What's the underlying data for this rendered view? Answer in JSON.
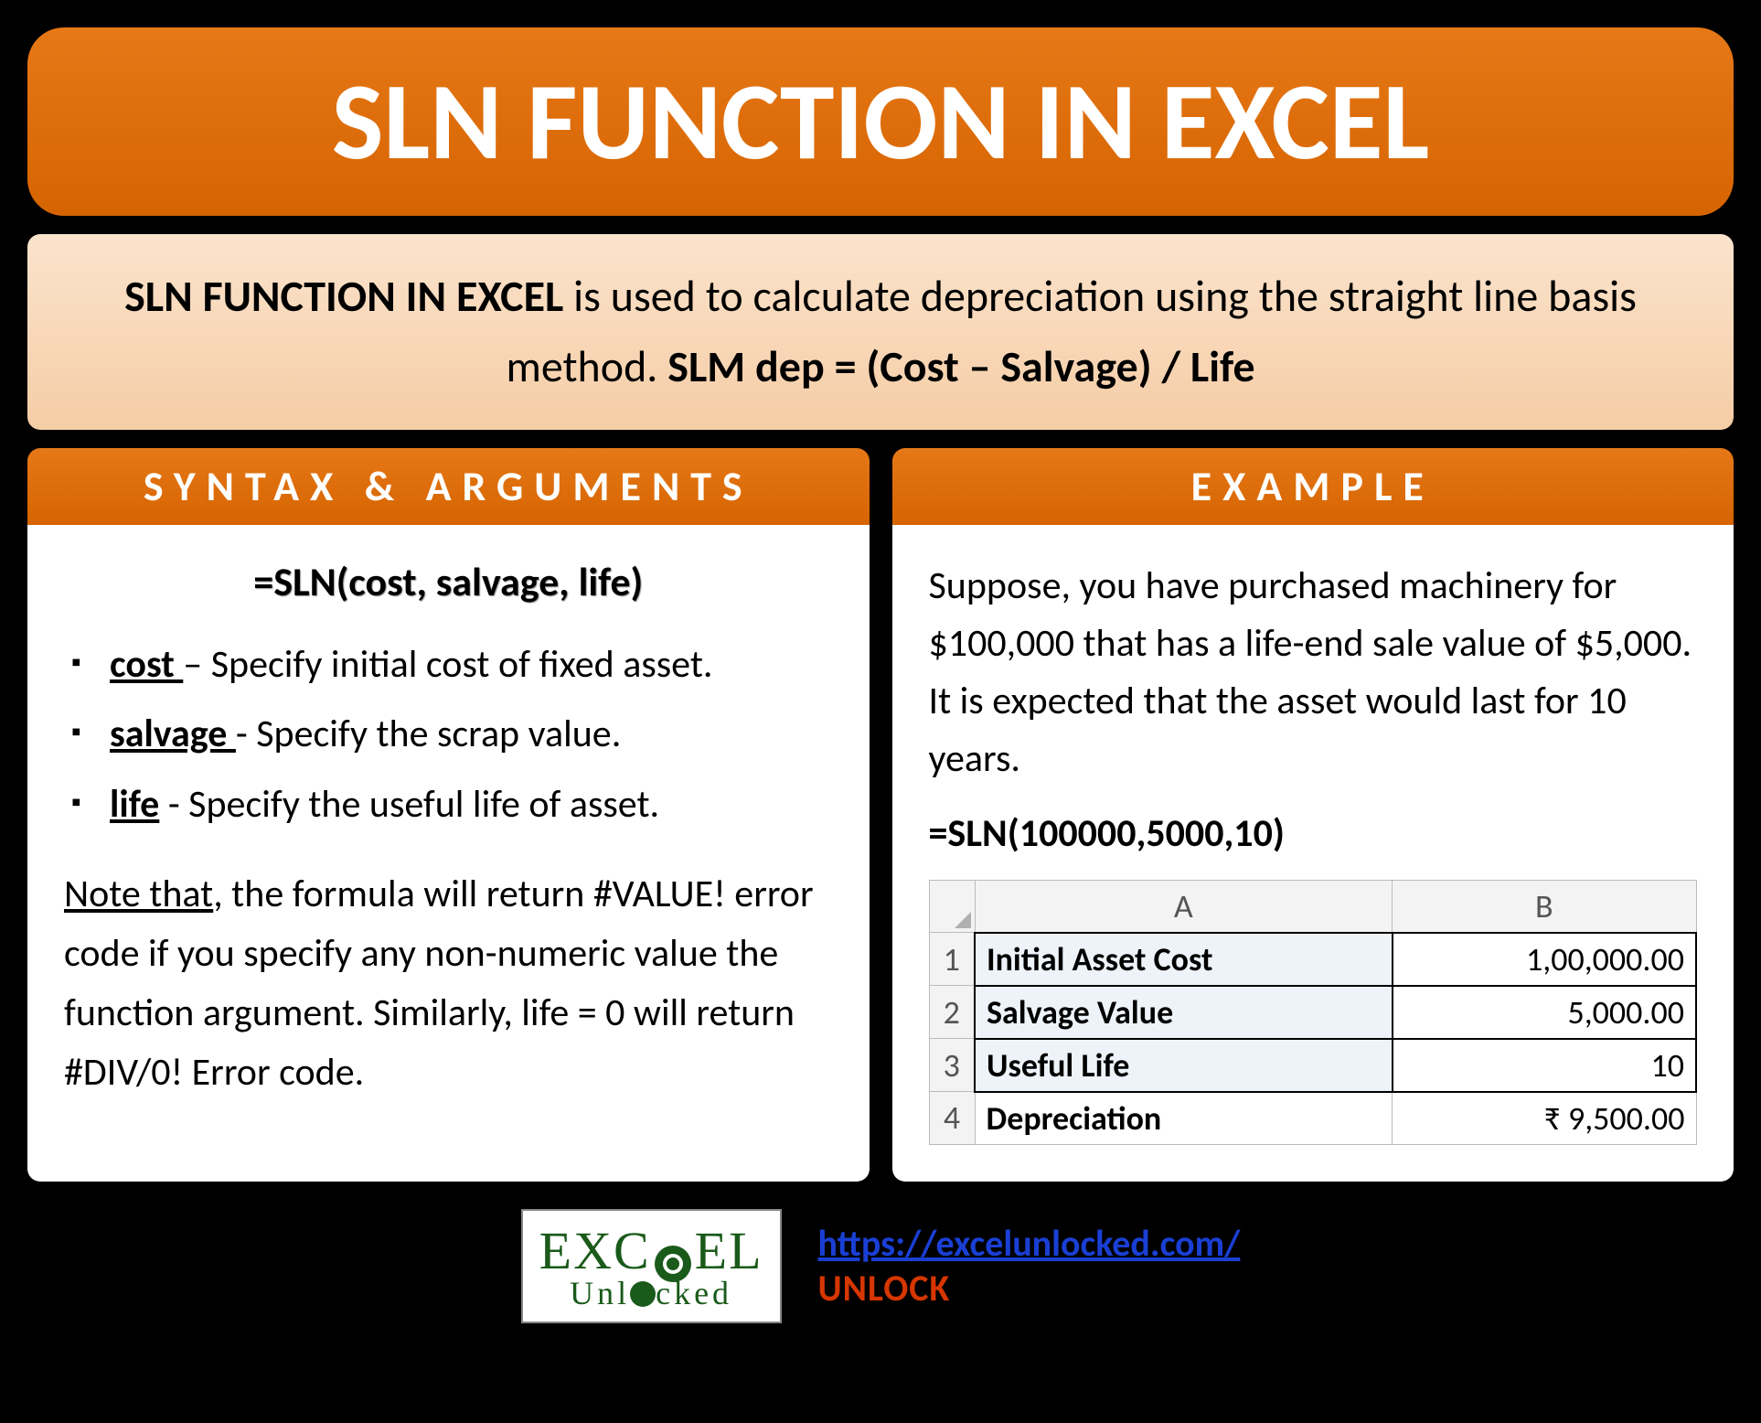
{
  "title": "SLN FUNCTION IN EXCEL",
  "description": {
    "bold_intro": "SLN FUNCTION IN EXCEL",
    "mid": " is used to calculate depreciation using the straight line basis method. ",
    "bold_formula": "SLM dep = (Cost – Salvage) / Life"
  },
  "syntax": {
    "header": "SYNTAX & ARGUMENTS",
    "formula": "=SLN(cost, salvage, life)",
    "args": [
      {
        "name": "cost ",
        "desc": "– Specify initial cost of fixed asset."
      },
      {
        "name": "salvage ",
        "desc": "- Specify the scrap value."
      },
      {
        "name": "life",
        "desc": " - Specify the useful life of asset."
      }
    ],
    "note_lead": "Note that",
    "note_rest": ", the formula will return #VALUE! error code if you specify any non-numeric value the function argument. Similarly, life = 0 will return #DIV/0! Error code."
  },
  "example": {
    "header": "EXAMPLE",
    "text": "Suppose, you have purchased machinery for $100,000 that has a life-end sale value of $5,000. It is expected that the asset would last for 10 years.",
    "formula": "=SLN(100000,5000,10)",
    "table": {
      "col_a": "A",
      "col_b": "B",
      "rows": [
        {
          "n": "1",
          "label": "Initial Asset Cost",
          "value": "1,00,000.00"
        },
        {
          "n": "2",
          "label": "Salvage Value",
          "value": "5,000.00"
        },
        {
          "n": "3",
          "label": "Useful Life",
          "value": "10"
        },
        {
          "n": "4",
          "label": "Depreciation",
          "value": "₹ 9,500.00"
        }
      ]
    }
  },
  "footer": {
    "logo_top": "EX   EL",
    "logo_c": "C",
    "logo_sub": "Unl   cked",
    "url": "https://excelunlocked.com/",
    "unlock": "UNLOCK"
  }
}
